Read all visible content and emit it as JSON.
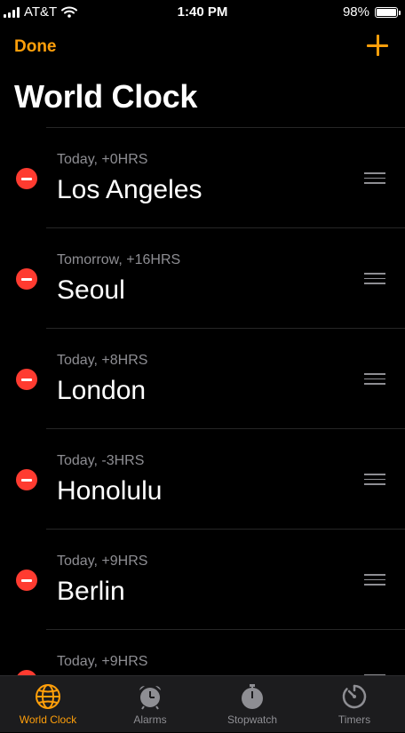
{
  "status_bar": {
    "carrier": "AT&T",
    "time": "1:40 PM",
    "battery": "98%",
    "battery_level": 0.98,
    "icons": [
      "signal-icon",
      "wifi-icon",
      "battery-icon"
    ]
  },
  "nav": {
    "done_label": "Done",
    "add_icon": "plus-icon"
  },
  "title": "World Clock",
  "clocks": [
    {
      "offset": "Today, +0HRS",
      "city": "Los Angeles"
    },
    {
      "offset": "Tomorrow, +16HRS",
      "city": "Seoul"
    },
    {
      "offset": "Today, +8HRS",
      "city": "London"
    },
    {
      "offset": "Today, -3HRS",
      "city": "Honolulu"
    },
    {
      "offset": "Today, +9HRS",
      "city": "Berlin"
    },
    {
      "offset": "Today, +9HRS",
      "city": ""
    }
  ],
  "tabs": [
    {
      "label": "World Clock",
      "icon": "globe-icon",
      "active": true
    },
    {
      "label": "Alarms",
      "icon": "alarm-clock-icon",
      "active": false
    },
    {
      "label": "Stopwatch",
      "icon": "stopwatch-icon",
      "active": false
    },
    {
      "label": "Timers",
      "icon": "timer-icon",
      "active": false
    }
  ],
  "colors": {
    "accent": "#ff9f0a",
    "delete": "#ff3b30",
    "secondary_text": "#8e8e93",
    "inactive_tab": "#8e8e93",
    "background": "#000000"
  }
}
